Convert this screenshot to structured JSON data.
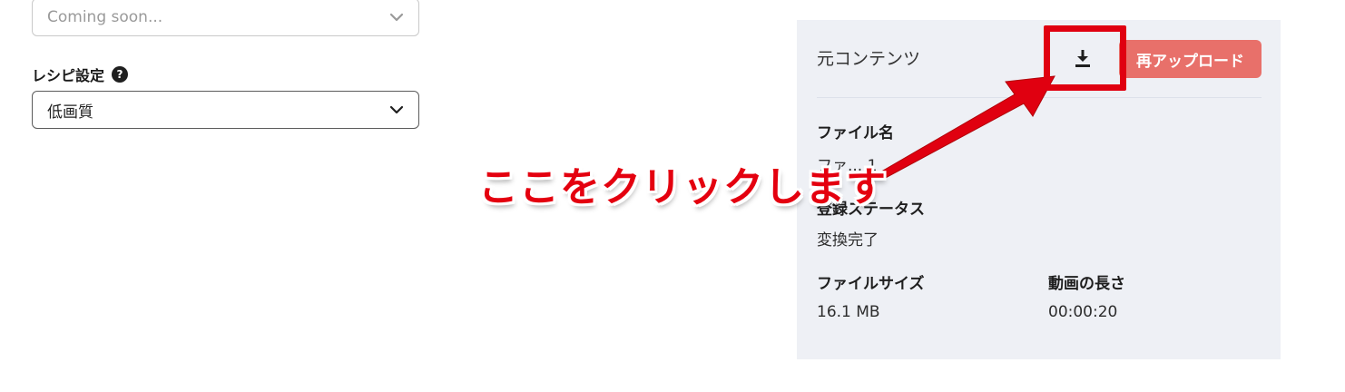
{
  "form": {
    "top_select": {
      "placeholder": "Coming soon..."
    },
    "recipe": {
      "label": "レシピ設定",
      "help_icon": "question-circle-icon",
      "value": "低画質"
    }
  },
  "panel": {
    "title": "元コンテンツ",
    "download_icon": "download-icon",
    "reupload_label": "再アップロード",
    "file_name_label": "ファイル名",
    "file_name_value": "ファ... 1",
    "status_label": "登録ステータス",
    "status_value": "変換完了",
    "size_label": "ファイルサイズ",
    "size_value": "16.1 MB",
    "duration_label": "動画の長さ",
    "duration_value": "00:00:20"
  },
  "annotation": {
    "callout_text": "ここをクリックします",
    "color": "#e00010"
  },
  "colors": {
    "panel_bg": "#eef0f5",
    "reupload_bg": "#e8706a"
  }
}
